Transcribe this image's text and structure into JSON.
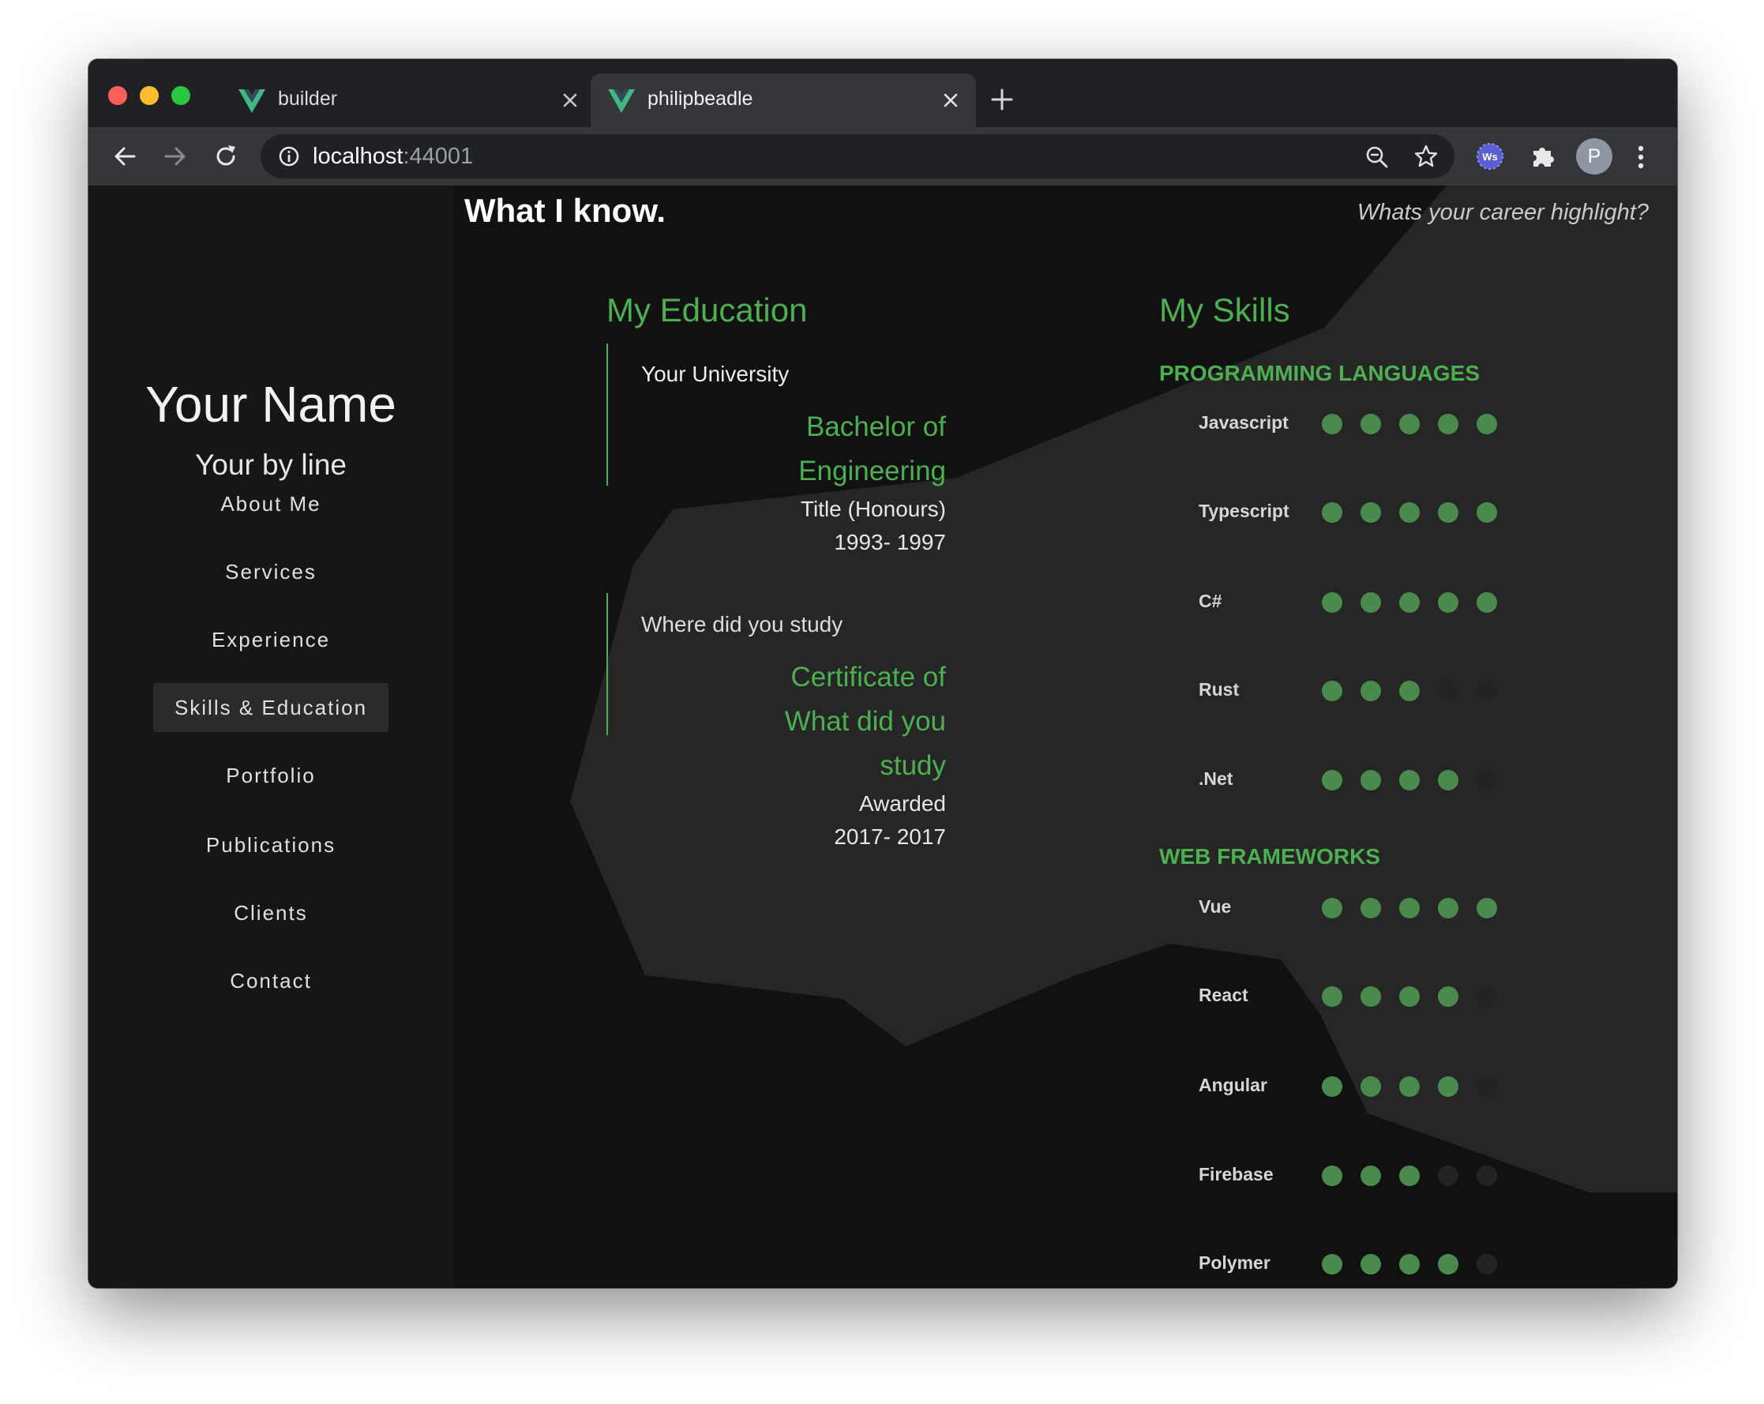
{
  "browser": {
    "tabs": [
      {
        "title": "builder",
        "active": false
      },
      {
        "title": "philipbeadle",
        "active": true
      }
    ],
    "url_host": "localhost",
    "url_port": ":44001",
    "profile_initial": "P",
    "extension_label": "Ws"
  },
  "sidebar": {
    "name": "Your Name",
    "byline": "Your by line",
    "items": [
      {
        "label": "About Me",
        "selected": false
      },
      {
        "label": "Services",
        "selected": false
      },
      {
        "label": "Experience",
        "selected": false
      },
      {
        "label": "Skills & Education",
        "selected": true
      },
      {
        "label": "Portfolio",
        "selected": false
      },
      {
        "label": "Publications",
        "selected": false
      },
      {
        "label": "Clients",
        "selected": false
      },
      {
        "label": "Contact",
        "selected": false
      }
    ]
  },
  "main": {
    "heading": "What I know.",
    "highlight": "Whats your career highlight?",
    "education": {
      "title": "My Education",
      "entries": [
        {
          "institution": "Your University",
          "degree_lines": [
            "Bachelor of",
            "Engineering"
          ],
          "subtitle": "Title (Honours)",
          "years": "1993- 1997"
        },
        {
          "institution": "Where did you study",
          "degree_lines": [
            "Certificate of",
            "What did you",
            "study"
          ],
          "subtitle": "Awarded",
          "years": "2017- 2017"
        }
      ]
    },
    "skills": {
      "title": "My Skills",
      "max_rating": 5,
      "categories": [
        {
          "name": "PROGRAMMING LANGUAGES",
          "items": [
            {
              "name": "Javascript",
              "rating": 5
            },
            {
              "name": "Typescript",
              "rating": 5
            },
            {
              "name": "C#",
              "rating": 5
            },
            {
              "name": "Rust",
              "rating": 3
            },
            {
              "name": ".Net",
              "rating": 4
            }
          ]
        },
        {
          "name": "WEB FRAMEWORKS",
          "items": [
            {
              "name": "Vue",
              "rating": 5
            },
            {
              "name": "React",
              "rating": 4
            },
            {
              "name": "Angular",
              "rating": 4
            },
            {
              "name": "Firebase",
              "rating": 3
            },
            {
              "name": "Polymer",
              "rating": 4
            }
          ]
        }
      ]
    }
  },
  "colors": {
    "accent": "#4caf50",
    "dot_on": "#4caf50",
    "dot_on_muted": "#4a8a4d",
    "dot_off": "#232323",
    "page_bg": "#111111",
    "sidebar_bg": "#161616"
  }
}
